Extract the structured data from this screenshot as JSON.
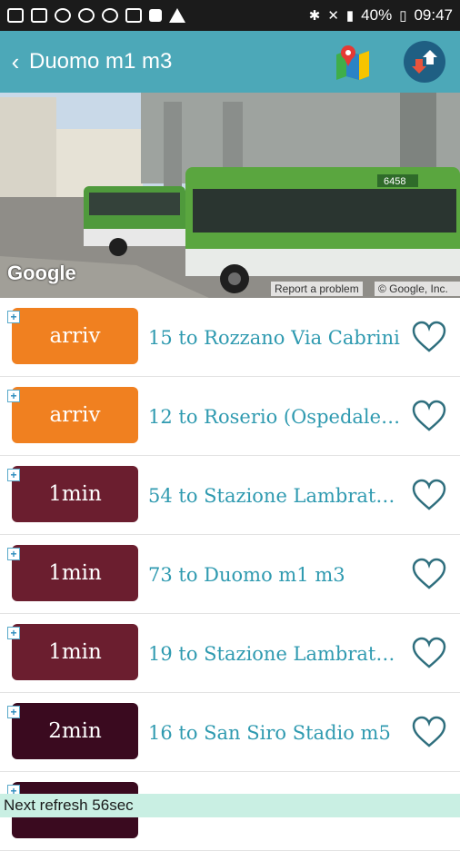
{
  "status_bar": {
    "battery": "40%",
    "time": "09:47"
  },
  "app_bar": {
    "title": "Duomo m1 m3"
  },
  "street_view": {
    "logo": "Google",
    "report": "Report a problem",
    "copyright": "© Google, Inc.",
    "bus_number": "6458"
  },
  "arrivals": [
    {
      "time": "arriv",
      "route": "15 to Rozzano Via Cabrini",
      "color": "#f08020"
    },
    {
      "time": "arriv",
      "route": "12 to Roserio (Ospedale S...",
      "color": "#f08020"
    },
    {
      "time": "1min",
      "route": "54 to Stazione Lambrate...",
      "color": "#6b1e2f"
    },
    {
      "time": "1min",
      "route": "73 to Duomo m1 m3",
      "color": "#6b1e2f"
    },
    {
      "time": "1min",
      "route": "19 to Stazione Lambrate...",
      "color": "#6b1e2f"
    },
    {
      "time": "2min",
      "route": "16 to San Siro Stadio m5",
      "color": "#3a0a1f"
    },
    {
      "time": "",
      "route": "",
      "color": "#3a0a1f"
    }
  ],
  "refresh": {
    "text": "Next refresh 56sec"
  },
  "colors": {
    "app_bar": "#4ca8b8",
    "route_text": "#2f9ab0",
    "refresh_bg": "#c9efe3"
  }
}
